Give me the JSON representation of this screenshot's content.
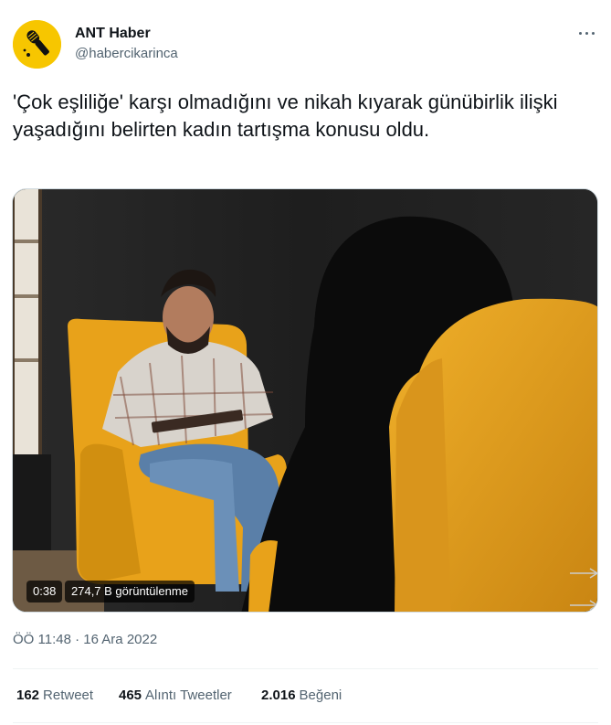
{
  "account": {
    "display_name": "ANT Haber",
    "handle": "@habercikarinca",
    "avatar_icon": "microphone-icon",
    "avatar_color": "#f7c600"
  },
  "tweet": {
    "text": "'Çok eşliliğe' karşı olmadığını ve nikah kıyarak günübirlik ilişki yaşadığını belirten kadın tartışma konusu oldu."
  },
  "video": {
    "duration": "0:38",
    "views": "274,7 B görüntülenme"
  },
  "meta": {
    "time": "ÖÖ 11:48",
    "separator": "·",
    "date": "16 Ara 2022"
  },
  "stats": {
    "retweets_count": "162",
    "retweets_label": "Retweet",
    "quotes_count": "465",
    "quotes_label": "Alıntı Tweetler",
    "likes_count": "2.016",
    "likes_label": "Beğeni"
  },
  "colors": {
    "text_primary": "#0f1419",
    "text_secondary": "#536471",
    "border": "#eff3f4",
    "chair_yellow": "#e8a21a"
  }
}
